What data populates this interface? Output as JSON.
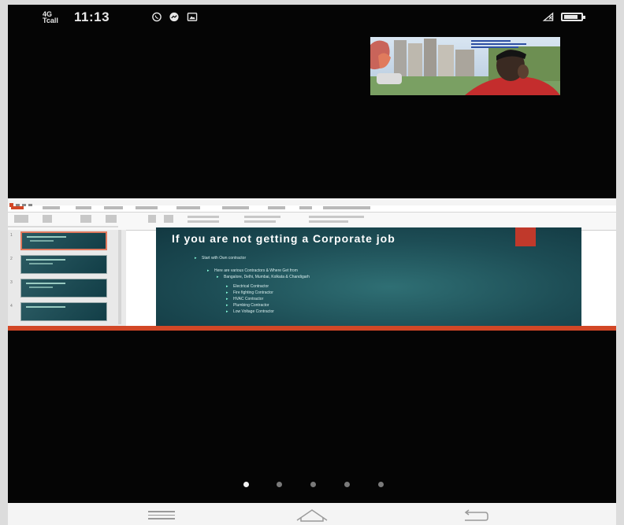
{
  "status_bar": {
    "signal_text": "4G",
    "signal_sub": "Tcall",
    "time": "11:13",
    "icons": [
      "whatsapp-icon",
      "messenger-icon",
      "gallery-icon"
    ],
    "right_icons": [
      "no-signal-icon",
      "battery-icon"
    ],
    "battery_level": 0.85
  },
  "self_view": {
    "overlay_text": ""
  },
  "presentation": {
    "slide_title": "If you are not getting a Corporate job",
    "bullets": [
      "Start with Own contractor",
      "Here are various Contractors & Where Get from",
      "Bangalore, Delhi, Mumbai, Kolkata & Chandigarh",
      "Electrical Contractor",
      "Fire fighting Contractor",
      "HVAC Contractor",
      "Plumbing Contractor",
      "Low Voltage Contractor"
    ],
    "thumbnail_count": 4,
    "active_thumbnail": 1,
    "accent": "#c0392b"
  },
  "pager": {
    "count": 5,
    "active": 1
  },
  "nav": {
    "icons": [
      "menu-icon",
      "home-icon",
      "back-icon"
    ]
  },
  "colors": {
    "screen_bg": "#050505",
    "slide_bg": "#1d4d55",
    "ppt_accent": "#d24726"
  }
}
